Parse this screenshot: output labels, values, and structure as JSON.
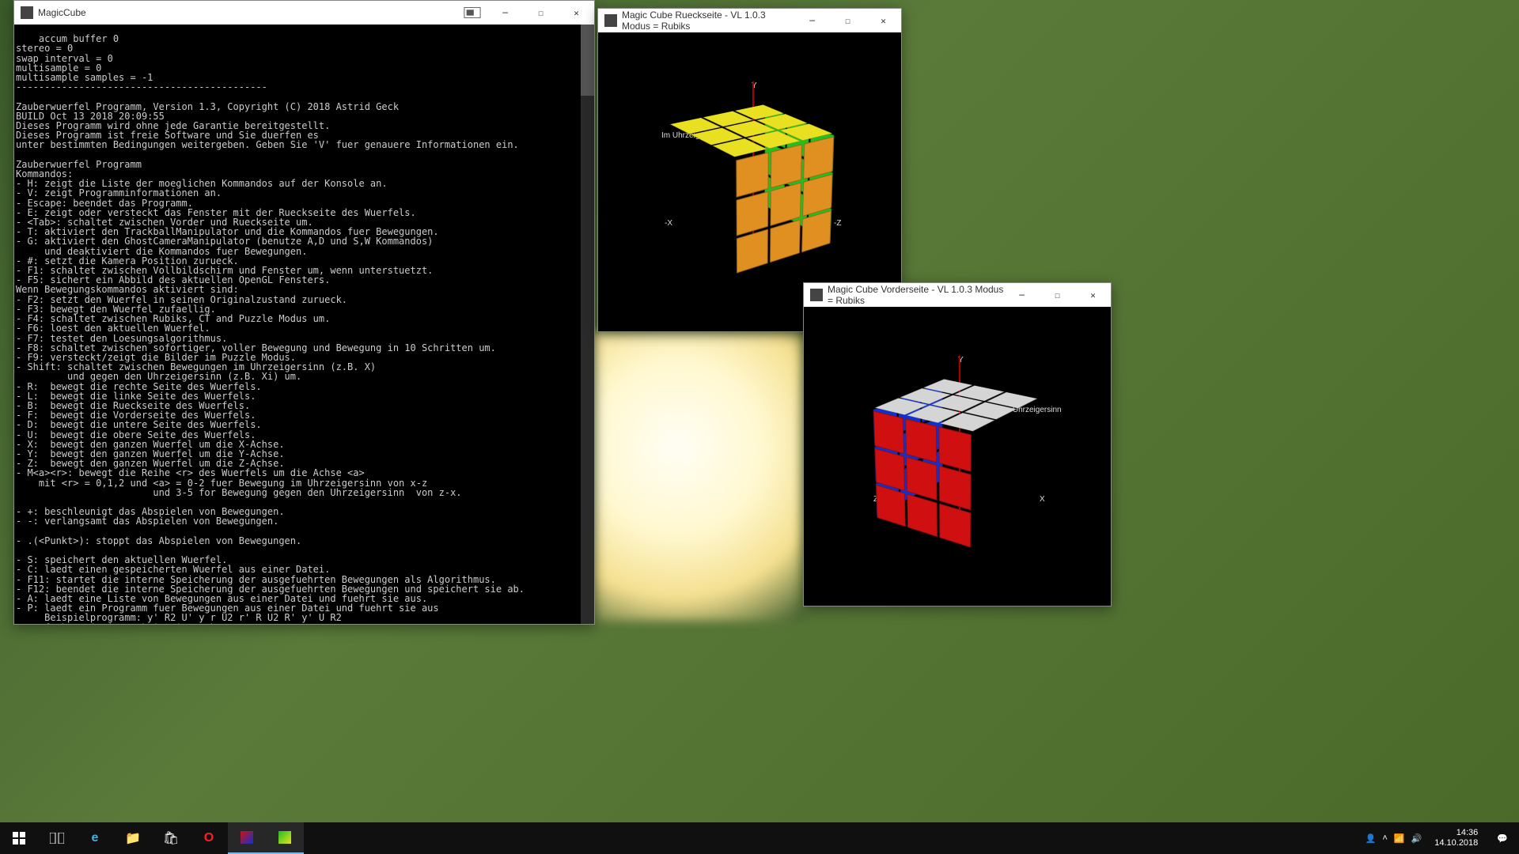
{
  "console": {
    "title": "MagicCube",
    "body": "accum buffer 0\nstereo = 0\nswap interval = 0\nmultisample = 0\nmultisample samples = -1\n--------------------------------------------\n\nZauberwuerfel Programm, Version 1.3, Copyright (C) 2018 Astrid Geck\nBUILD Oct 13 2018 20:09:55\nDieses Programm wird ohne jede Garantie bereitgestellt.\nDieses Programm ist freie Software und Sie duerfen es\nunter bestimmten Bedingungen weitergeben. Geben Sie 'V' fuer genauere Informationen ein.\n\nZauberwuerfel Programm\nKommandos:\n- H: zeigt die Liste der moeglichen Kommandos auf der Konsole an.\n- V: zeigt Programminformationen an.\n- Escape: beendet das Programm.\n- E: zeigt oder versteckt das Fenster mit der Rueckseite des Wuerfels.\n- <Tab>: schaltet zwischen Vorder und Rueckseite um.\n- T: aktiviert den TrackballManipulator und die Kommandos fuer Bewegungen.\n- G: aktiviert den GhostCameraManipulator (benutze A,D und S,W Kommandos)\n     und deaktiviert die Kommandos fuer Bewegungen.\n- #: setzt die Kamera Position zurueck.\n- F1: schaltet zwischen Vollbildschirm und Fenster um, wenn unterstuetzt.\n- F5: sichert ein Abbild des aktuellen OpenGL Fensters.\nWenn Bewegungskommandos aktiviert sind:\n- F2: setzt den Wuerfel in seinen Originalzustand zurueck.\n- F3: bewegt den Wuerfel zufaellig.\n- F4: schaltet zwischen Rubiks, CT and Puzzle Modus um.\n- F6: loest den aktuellen Wuerfel.\n- F7: testet den Loesungsalgorithmus.\n- F8: schaltet zwischen sofortiger, voller Bewegung und Bewegung in 10 Schritten um.\n- F9: versteckt/zeigt die Bilder im Puzzle Modus.\n- Shift: schaltet zwischen Bewegungen im Uhrzeigersinn (z.B. X)\n         und gegen den Uhrzeigersinn (z.B. Xi) um.\n- R:  bewegt die rechte Seite des Wuerfels.\n- L:  bewegt die linke Seite des Wuerfels.\n- B:  bewegt die Rueckseite des Wuerfels.\n- F:  bewegt die Vorderseite des Wuerfels.\n- D:  bewegt die untere Seite des Wuerfels.\n- U:  bewegt die obere Seite des Wuerfels.\n- X:  bewegt den ganzen Wuerfel um die X-Achse.\n- Y:  bewegt den ganzen Wuerfel um die Y-Achse.\n- Z:  bewegt den ganzen Wuerfel um die Z-Achse.\n- M<a><r>: bewegt die Reihe <r> des Wuerfels um die Achse <a>\n    mit <r> = 0,1,2 und <a> = 0-2 fuer Bewegung im Uhrzeigersinn von x-z\n                        und 3-5 for Bewegung gegen den Uhrzeigersinn  von z-x.\n\n- +: beschleunigt das Abspielen von Bewegungen.\n- -: verlangsamt das Abspielen von Bewegungen.\n\n- .(<Punkt>): stoppt das Abspielen von Bewegungen.\n\n- S: speichert den aktuellen Wuerfel.\n- C: laedt einen gespeicherten Wuerfel aus einer Datei.\n- F11: startet die interne Speicherung der ausgefuehrten Bewegungen als Algorithmus.\n- F12: beendet die interne Speicherung der ausgefuehrten Bewegungen und speichert sie ab.\n- A: laedt eine Liste von Bewegungen aus einer Datei und fuehrt sie aus.\n- P: laedt ein Programm fuer Bewegungen aus einer Datei und fuehrt sie aus\n     Beispielprogramm: y' R2 U' y r U2 r' R U2 R' y' U R2\n- Q: fuehrt ein interaktiv eingegebenes Programm aus."
  },
  "rear": {
    "title": "Magic Cube Rueckseite - VL 1.0.3 Modus = Rubiks",
    "rotation_label": "Im Uhrzeigersinn",
    "axis": {
      "y": "Y",
      "x": "-X",
      "z": "-Z"
    },
    "colors": {
      "top": "#e8e020",
      "left": "#e09020",
      "right": "#20c020"
    }
  },
  "front": {
    "title": "Magic Cube Vorderseite - VL 1.0.3 Modus = Rubiks",
    "rotation_label": "Im Uhrzeigersinn",
    "axis": {
      "y": "Y",
      "x": "X",
      "z": "Z"
    },
    "colors": {
      "top": "#d5d5d5",
      "left": "#1030d0",
      "right": "#d01010"
    }
  },
  "taskbar": {
    "clock_time": "14:36",
    "clock_date": "14.10.2018"
  }
}
